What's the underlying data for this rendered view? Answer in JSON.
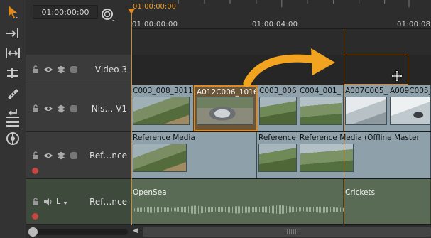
{
  "header": {
    "timecode": "01:00:00:00",
    "playhead_timecode": "01:00:00:00",
    "ruler_labels": [
      "01:00:00:00",
      "01:00:04:00",
      "01:00:08:00"
    ]
  },
  "tools": [
    "select-arrow-icon",
    "insert-edit-icon",
    "ripple-expand-icon",
    "trim-icon",
    "razor-icon",
    "lift-icon",
    "overwrite-icon",
    "track-spin-icon"
  ],
  "tracks": {
    "video3": {
      "name": "Video 3"
    },
    "video1": {
      "name": "Nis… V1",
      "clips": [
        "C003_008_3011",
        "A012C006_1016",
        "C003_006",
        "C004_001_",
        "A007C005_",
        "A009C005_"
      ]
    },
    "reference": {
      "name": "Ref…nce",
      "clips": [
        "Reference Media",
        "Reference",
        "Reference Media (Offline Master"
      ]
    },
    "audio": {
      "name": "Ref…nce",
      "channel": "L",
      "clips": [
        "OpenSea",
        "Crickets"
      ]
    }
  },
  "colors": {
    "accent": "#f2a320",
    "playhead": "#d88722",
    "clip_video": "#8ea1ab",
    "clip_audio": "#5a6b55"
  }
}
